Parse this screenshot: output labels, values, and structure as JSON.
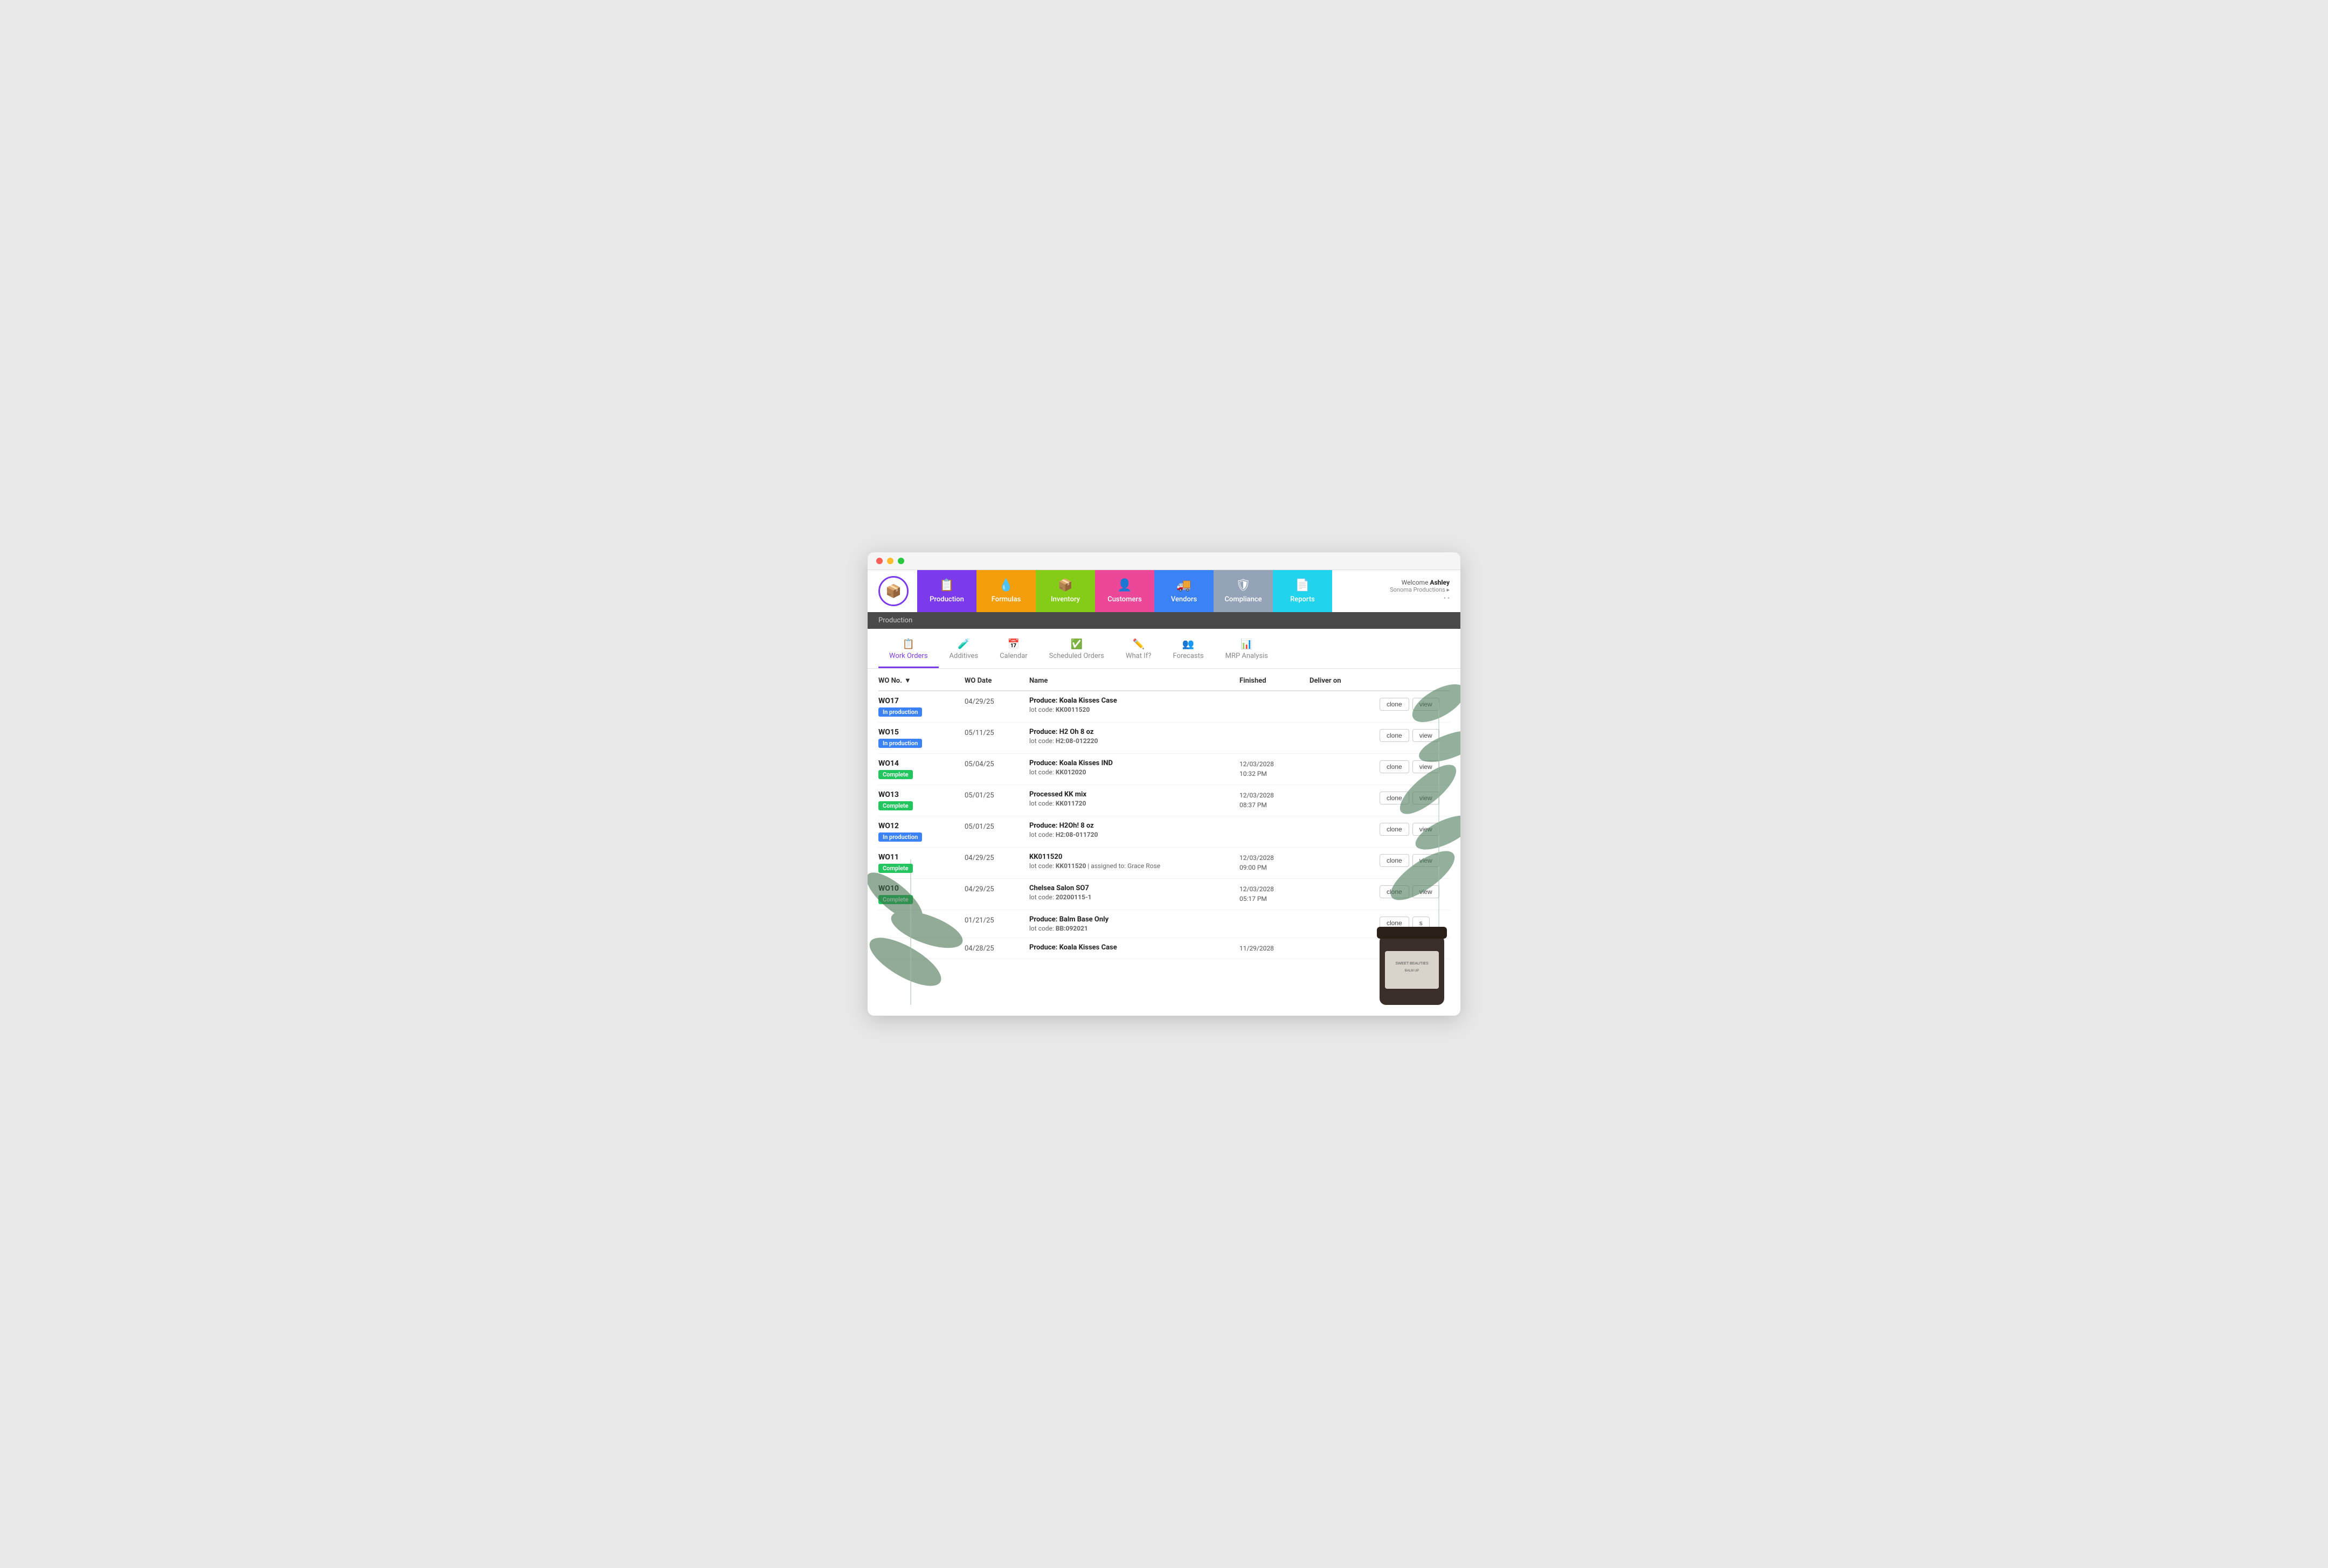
{
  "window": {
    "dots": [
      "red",
      "yellow",
      "green"
    ]
  },
  "header": {
    "logo_icon": "📦",
    "welcome_prefix": "Welcome",
    "welcome_name": "Ashley",
    "welcome_sub": "Sonoma Productions ▸",
    "settings_dots": "• •",
    "nav": [
      {
        "id": "production",
        "label": "Production",
        "icon": "📋",
        "color": "nav-production"
      },
      {
        "id": "formulas",
        "label": "Formulas",
        "icon": "💧",
        "color": "nav-formulas"
      },
      {
        "id": "inventory",
        "label": "Inventory",
        "icon": "📦",
        "color": "nav-inventory"
      },
      {
        "id": "customers",
        "label": "Customers",
        "icon": "👤",
        "color": "nav-customers"
      },
      {
        "id": "vendors",
        "label": "Vendors",
        "icon": "🚚",
        "color": "nav-vendors"
      },
      {
        "id": "compliance",
        "label": "Compliance",
        "icon": "🛡",
        "color": "nav-compliance"
      },
      {
        "id": "reports",
        "label": "Reports",
        "icon": "📄",
        "color": "nav-reports"
      }
    ]
  },
  "section": {
    "title": "Production"
  },
  "tabs": [
    {
      "id": "work-orders",
      "label": "Work Orders",
      "icon": "📋",
      "active": true
    },
    {
      "id": "additives",
      "label": "Additives",
      "icon": "🧪",
      "active": false
    },
    {
      "id": "calendar",
      "label": "Calendar",
      "icon": "📅",
      "active": false
    },
    {
      "id": "scheduled-orders",
      "label": "Scheduled Orders",
      "icon": "✅",
      "active": false
    },
    {
      "id": "what-if",
      "label": "What If?",
      "icon": "✏️",
      "active": false
    },
    {
      "id": "forecasts",
      "label": "Forecasts",
      "icon": "👥",
      "active": false
    },
    {
      "id": "mrp-analysis",
      "label": "MRP Analysis",
      "icon": "📊",
      "active": false
    }
  ],
  "table": {
    "columns": [
      {
        "id": "wo-no",
        "label": "WO No.",
        "sortable": true
      },
      {
        "id": "wo-date",
        "label": "WO Date"
      },
      {
        "id": "name",
        "label": "Name"
      },
      {
        "id": "finished",
        "label": "Finished"
      },
      {
        "id": "deliver-on",
        "label": "Deliver on"
      },
      {
        "id": "actions",
        "label": ""
      }
    ],
    "rows": [
      {
        "wo_num": "WO17",
        "status": "In production",
        "status_type": "inprod",
        "date": "04/29/25",
        "name": "Produce: Koala Kisses Case",
        "lot_code": "KK0011520",
        "lot_label": "lot code:",
        "finished": "",
        "deliver_on": "",
        "assigned_to": "",
        "actions": [
          "clone",
          "view"
        ]
      },
      {
        "wo_num": "WO15",
        "status": "In production",
        "status_type": "inprod",
        "date": "05/11/25",
        "name": "Produce: H2 Oh 8 oz",
        "lot_code": "H2:08-012220",
        "lot_label": "lot code:",
        "finished": "",
        "deliver_on": "",
        "assigned_to": "",
        "actions": [
          "clone",
          "view"
        ]
      },
      {
        "wo_num": "WO14",
        "status": "Complete",
        "status_type": "complete",
        "date": "05/04/25",
        "name": "Produce: Koala Kisses IND",
        "lot_code": "KK012020",
        "lot_label": "lot code:",
        "finished": "12/03/2028\n10:32 PM",
        "deliver_on": "",
        "assigned_to": "",
        "actions": [
          "clone",
          "view"
        ]
      },
      {
        "wo_num": "WO13",
        "status": "Complete",
        "status_type": "complete",
        "date": "05/01/25",
        "name": "Processed KK mix",
        "lot_code": "KK011720",
        "lot_label": "lot code:",
        "finished": "12/03/2028\n08:37 PM",
        "deliver_on": "",
        "assigned_to": "",
        "actions": [
          "clone",
          "view"
        ]
      },
      {
        "wo_num": "WO12",
        "status": "In production",
        "status_type": "inprod",
        "date": "05/01/25",
        "name": "Produce: H2Oh! 8 oz",
        "lot_code": "H2:08-011720",
        "lot_label": "lot code:",
        "finished": "",
        "deliver_on": "",
        "assigned_to": "",
        "actions": [
          "clone",
          "view"
        ]
      },
      {
        "wo_num": "WO11",
        "status": "Complete",
        "status_type": "complete",
        "date": "04/29/25",
        "name": "KK011520",
        "lot_code": "KK011520",
        "lot_label": "lot code:",
        "finished": "12/03/2028\n09:00 PM",
        "deliver_on": "",
        "assigned_to": "| assigned to: Grace Rose",
        "actions": [
          "clone",
          "view"
        ]
      },
      {
        "wo_num": "WO10",
        "status": "Complete",
        "status_type": "complete",
        "date": "04/29/25",
        "name": "Chelsea Salon SO7",
        "lot_code": "20200115-1",
        "lot_label": "lot code:",
        "finished": "12/03/2028\n05:17 PM",
        "deliver_on": "",
        "assigned_to": "",
        "actions": [
          "clone",
          "view"
        ]
      },
      {
        "wo_num": "",
        "status": "",
        "status_type": "",
        "date": "01/21/25",
        "name": "Produce: Balm Base Only",
        "lot_code": "BB:092021",
        "lot_label": "lot code:",
        "finished": "",
        "deliver_on": "",
        "assigned_to": "",
        "actions": [
          "clone",
          "s"
        ]
      },
      {
        "wo_num": "",
        "status": "",
        "status_type": "",
        "date": "04/28/25",
        "name": "Produce: Koala Kisses Case",
        "lot_code": "",
        "lot_label": "",
        "finished": "11/29/2028",
        "deliver_on": "",
        "assigned_to": "",
        "actions": []
      }
    ]
  }
}
